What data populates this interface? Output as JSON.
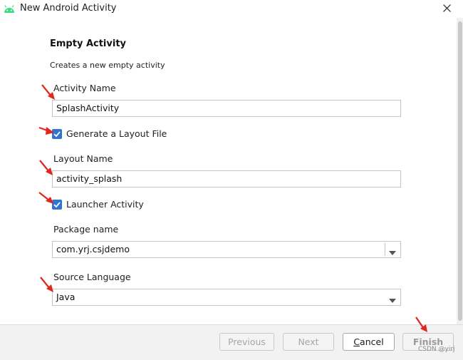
{
  "window": {
    "title": "New Android Activity",
    "app_icon": "android-icon",
    "close_icon": "close-icon"
  },
  "template": {
    "heading": "Empty Activity",
    "description": "Creates a new empty activity"
  },
  "form": {
    "activity_name": {
      "label": "Activity Name",
      "value": "SplashActivity"
    },
    "generate_layout": {
      "label": "Generate a Layout File",
      "checked": true
    },
    "layout_name": {
      "label": "Layout Name",
      "value": "activity_splash"
    },
    "launcher_activity": {
      "label": "Launcher Activity",
      "checked": true
    },
    "package_name": {
      "label": "Package name",
      "value": "com.yrj.csjdemo"
    },
    "source_language": {
      "label": "Source Language",
      "value": "Java"
    }
  },
  "buttons": {
    "previous": "Previous",
    "next": "Next",
    "cancel_prefix": "",
    "cancel_mnemonic": "C",
    "cancel_rest": "ancel",
    "finish": "Finish"
  },
  "watermark": "CSDN @yirj",
  "colors": {
    "checkbox": "#2f74d0",
    "annotation_arrow": "#e0261d",
    "footer": "#f2f2f2"
  }
}
